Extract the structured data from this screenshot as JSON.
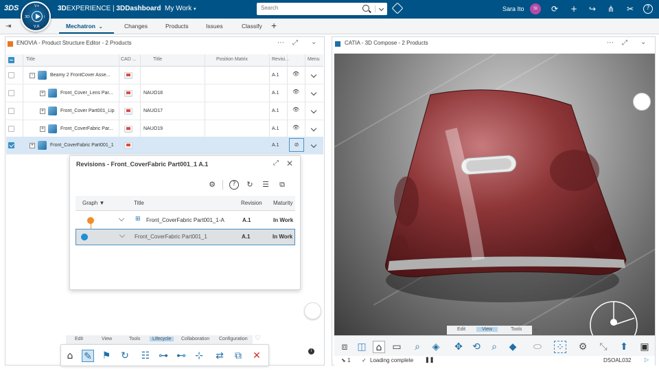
{
  "topbar": {
    "logo": "3DS",
    "compass_labels": [
      "3D",
      "V,R",
      "i",
      "V+"
    ],
    "brand_prefix": "3D",
    "brand_main": "EXPERIENCE",
    "brand_sep": " | ",
    "brand_dash": "3DDashboard",
    "brand_context": "My Work",
    "search_placeholder": "Search",
    "user_name": "Sara Ito",
    "user_initials": "SI",
    "icons": [
      "share-icon",
      "add-icon",
      "forward-icon",
      "network-icon",
      "tools-icon",
      "help-icon"
    ]
  },
  "tabs": {
    "items": [
      {
        "label": "Mechatron",
        "active": true
      },
      {
        "label": "Changes"
      },
      {
        "label": "Products"
      },
      {
        "label": "Issues"
      },
      {
        "label": "Classify"
      }
    ],
    "add": "+"
  },
  "left_panel": {
    "title": "ENOVIA - Product Structure Editor - 2 Products",
    "columns": [
      "Title",
      "CAD ...",
      "Title",
      "Position Matrix",
      "Revisi...",
      "Menu"
    ],
    "rows": [
      {
        "name": "Beamy 2 FrontCover Asse...",
        "title": "",
        "rev": "A.1",
        "checked": false,
        "level": 0
      },
      {
        "name": "Front_Cover_Lens Par...",
        "title": "NAUO18",
        "rev": "A.1",
        "checked": false,
        "level": 1
      },
      {
        "name": "Front_Cover Part001_Lip",
        "title": "NAUO17",
        "rev": "A.1",
        "checked": false,
        "level": 1
      },
      {
        "name": "Front_CoverFabric Par...",
        "title": "NAUO19",
        "rev": "A.1",
        "checked": false,
        "level": 1
      },
      {
        "name": "Front_CoverFabric Part001_1",
        "title": "",
        "rev": "A.1",
        "checked": true,
        "level": 0
      }
    ]
  },
  "revisions": {
    "title": "Revisions - Front_CoverFabric Part001_1 A.1",
    "columns": [
      "Graph",
      "Title",
      "Revision",
      "Maturity"
    ],
    "rows": [
      {
        "title": "Front_CoverFabric Part001_1-A",
        "revision": "A.1",
        "maturity": "In Work",
        "color": "#f28c28"
      },
      {
        "title": "Front_CoverFabric Part001_1",
        "revision": "A.1",
        "maturity": "In Work",
        "color": "#1f8fd6"
      }
    ]
  },
  "left_menu": {
    "items": [
      "Edit",
      "View",
      "Tools",
      "Lifecycle",
      "Collaboration",
      "Configuration"
    ],
    "active": "Lifecycle"
  },
  "left_toolbar_icons": [
    "home-icon",
    "pencil-icon",
    "bookmark-icon",
    "refresh-icon",
    "list-icon",
    "add-node-icon",
    "add-branch-icon",
    "insert-icon",
    "replace-icon",
    "merge-icon",
    "close-icon"
  ],
  "right_panel": {
    "title": "CATIA - 3D Compose - 2 Products"
  },
  "right_menu": {
    "items": [
      "Edit",
      "View",
      "Tools"
    ],
    "active": "View"
  },
  "right_toolbar_icons": [
    "assembly-icon",
    "cube-icon",
    "home-icon",
    "panel-icon",
    "zoom-fit-icon",
    "cube-view-icon",
    "move-icon",
    "rotate-icon",
    "zoom-icon",
    "box-icon",
    "cylinder-icon",
    "select-icon",
    "gear-icon",
    "compass-icon",
    "arrow-up-icon",
    "layout-icon"
  ],
  "status": {
    "count": "1",
    "message": "Loading complete",
    "code": "DSOAL032"
  }
}
